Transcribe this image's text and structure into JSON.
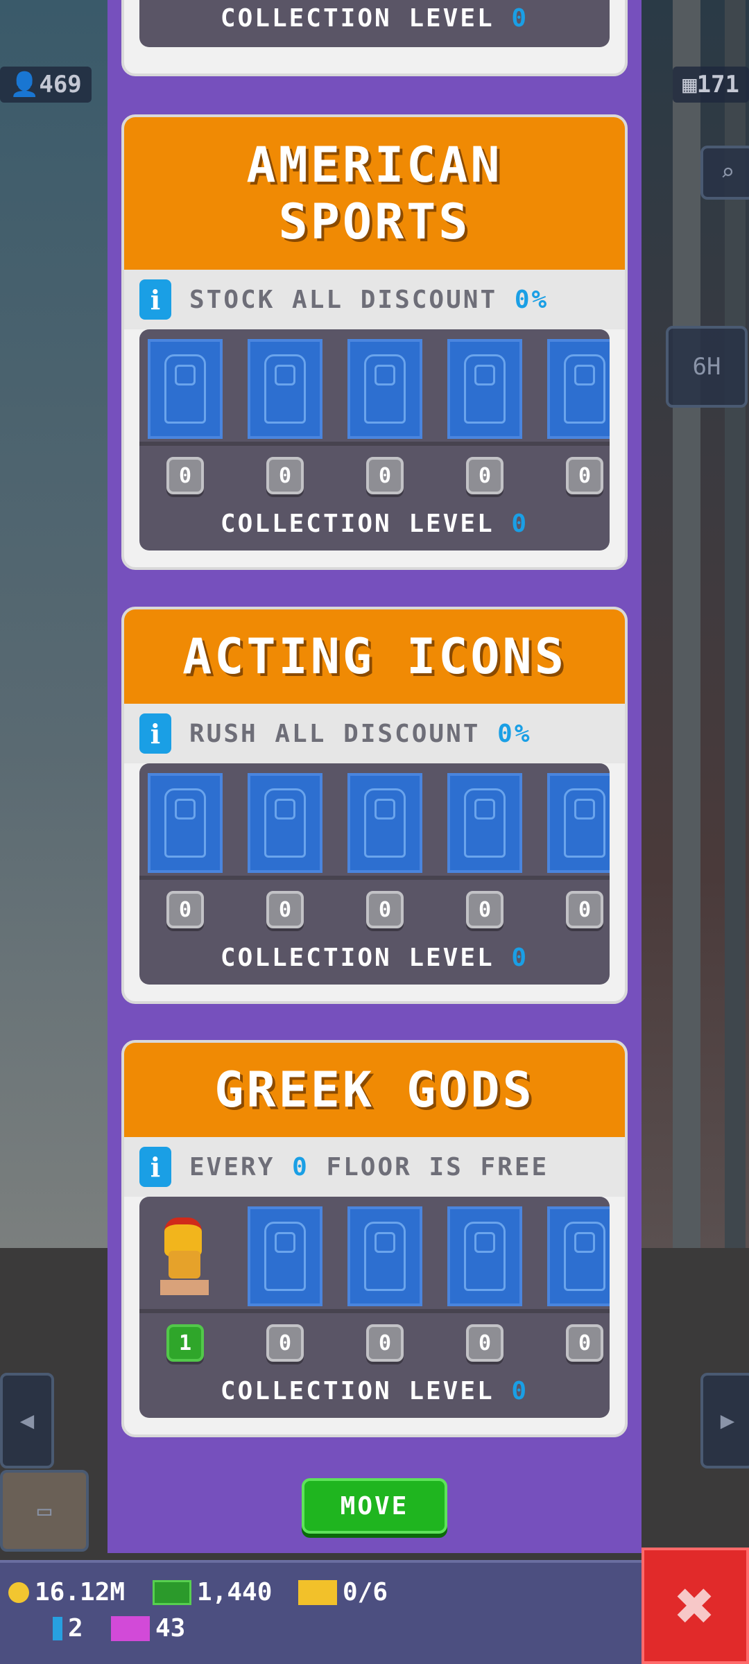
{
  "hud": {
    "left_counter": "469",
    "right_counter": "171",
    "timer_label": "6H"
  },
  "top_stub": {
    "collection_label": "COLLECTION LEVEL",
    "collection_level": "0"
  },
  "collections": [
    {
      "title": "AMERICAN SPORTS",
      "info_prefix": "STOCK ALL DISCOUNT",
      "info_value": "0%",
      "counts": [
        "0",
        "0",
        "0",
        "0",
        "0"
      ],
      "collection_label": "COLLECTION LEVEL",
      "collection_level": "0"
    },
    {
      "title": "ACTING ICONS",
      "info_prefix": "RUSH ALL DISCOUNT",
      "info_value": "0%",
      "counts": [
        "0",
        "0",
        "0",
        "0",
        "0"
      ],
      "collection_label": "COLLECTION LEVEL",
      "collection_level": "0"
    },
    {
      "title": "GREEK GODS",
      "info_prefix": "EVERY",
      "info_value": "0",
      "info_suffix": "FLOOR IS FREE",
      "counts": [
        "1",
        "0",
        "0",
        "0",
        "0"
      ],
      "collection_label": "COLLECTION LEVEL",
      "collection_level": "0"
    }
  ],
  "move_button": "MOVE",
  "bottom_bar": {
    "coins": "16.12M",
    "bux": "1,440",
    "tickets": "0/6",
    "gems": "2",
    "vip": "43"
  },
  "close_symbol": "✖",
  "colors": {
    "panel": "#7650bd",
    "header": "#f08a04",
    "accent": "#1a9fe5",
    "move": "#1fb51f",
    "close": "#e12a2a"
  }
}
